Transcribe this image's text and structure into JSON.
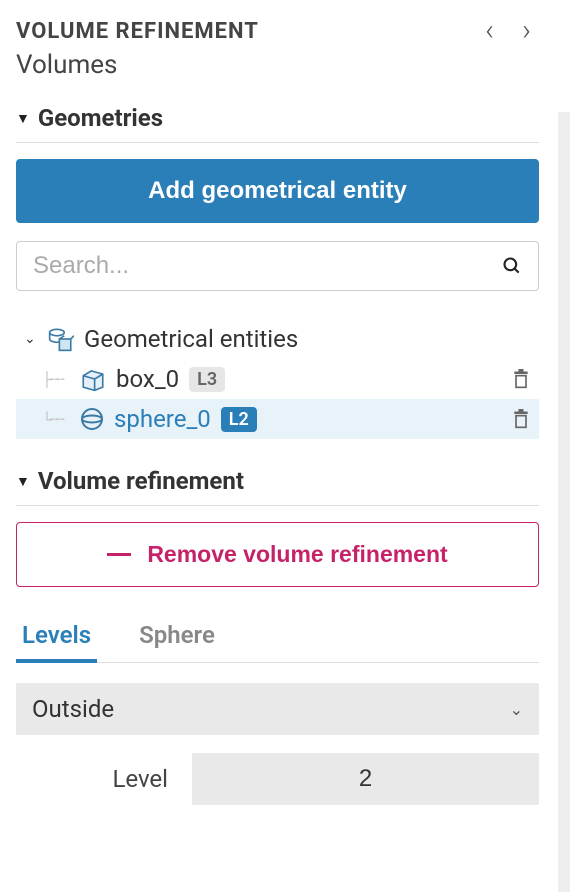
{
  "header": {
    "title": "VOLUME REFINEMENT",
    "subtitle": "Volumes"
  },
  "geometries": {
    "section_label": "Geometries",
    "add_button": "Add geometrical entity",
    "search_placeholder": "Search...",
    "tree_root_label": "Geometrical entities",
    "items": [
      {
        "name": "box_0",
        "level_badge": "L3",
        "selected": false
      },
      {
        "name": "sphere_0",
        "level_badge": "L2",
        "selected": true
      }
    ]
  },
  "volume_refinement": {
    "section_label": "Volume refinement",
    "remove_button": "Remove volume refinement",
    "tabs": [
      {
        "label": "Levels",
        "active": true
      },
      {
        "label": "Sphere",
        "active": false
      }
    ],
    "dropdown_value": "Outside",
    "level_label": "Level",
    "level_value": "2"
  }
}
